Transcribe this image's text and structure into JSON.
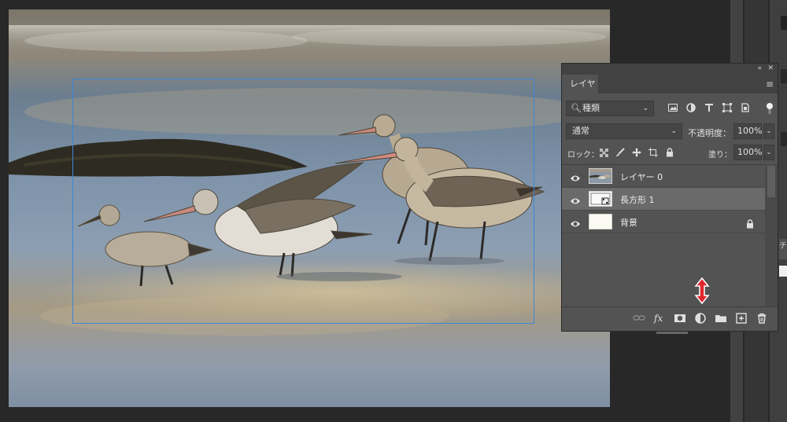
{
  "layers_panel": {
    "tab_label": "レイヤー",
    "filter": {
      "label": "種類"
    },
    "blend_mode": "通常",
    "opacity": {
      "label": "不透明度：",
      "value": "100%"
    },
    "lock_label": "ロック：",
    "fill": {
      "label": "塗り：",
      "value": "100%"
    },
    "layers": [
      {
        "name": "レイヤー 0",
        "selected": false,
        "locked": false
      },
      {
        "name": "長方形 1",
        "selected": true,
        "locked": false
      },
      {
        "name": "背景",
        "selected": false,
        "locked": true
      }
    ]
  },
  "dock": {
    "tab_glyph": "チ"
  },
  "colors": {
    "selection": "#3e86d6",
    "panel_bg": "#535353",
    "selected_row": "#6a6a6a",
    "marker_red": "#e0262d"
  },
  "icons": {
    "filter_icons": [
      "image-filter-icon",
      "adjustment-filter-icon",
      "text-filter-icon",
      "shape-filter-icon",
      "smart-object-filter-icon"
    ],
    "lock_icons": [
      "lock-transparent-icon",
      "lock-paint-icon",
      "lock-position-icon",
      "lock-artboard-icon",
      "lock-all-icon"
    ],
    "bottom_icons": [
      "link-layers-icon",
      "fx-icon",
      "mask-icon",
      "adjustment-layer-icon",
      "group-icon",
      "new-layer-icon",
      "delete-icon"
    ]
  }
}
